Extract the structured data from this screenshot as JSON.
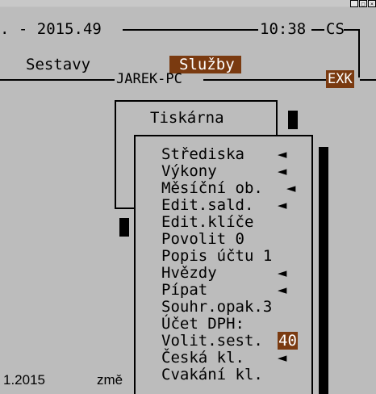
{
  "window": {
    "minimize_icon": "_",
    "maximize_icon": "□",
    "close_icon": "×"
  },
  "status": {
    "left_text": ". - 2015.49",
    "time": "10:38",
    "code": "CS"
  },
  "menu": {
    "item1": "Sestavy",
    "item2": "Služby"
  },
  "bar2": {
    "computer": "JAREK-PC",
    "badge": "EXK"
  },
  "popup1": {
    "title": "Tiskárna"
  },
  "submenu": {
    "items": [
      {
        "label": "Střediska",
        "suffix": "◄"
      },
      {
        "label": "Výkony",
        "suffix": "◄"
      },
      {
        "label": "Měsíční ob.",
        "suffix": "◄"
      },
      {
        "label": "Edit.sald.",
        "suffix": "◄"
      },
      {
        "label": "Edit.klíče",
        "suffix": ""
      },
      {
        "label": "Povolit 0",
        "suffix": ""
      },
      {
        "label": "Popis účtu 1",
        "suffix": ""
      },
      {
        "label": "Hvězdy",
        "suffix": "◄"
      },
      {
        "label": "Pípat",
        "suffix": "◄"
      },
      {
        "label": "Souhr.opak.3",
        "suffix": ""
      },
      {
        "label": "Účet DPH:",
        "suffix": ""
      },
      {
        "label": "Volit.sest.",
        "suffix": "40"
      },
      {
        "label": "Česká kl.",
        "suffix": "◄"
      },
      {
        "label": "Cvakání kl.",
        "suffix": ""
      }
    ]
  },
  "bottom": {
    "date_text": "1.2015",
    "word": "změ"
  },
  "colors": {
    "highlight": "#7a3a10",
    "background": "#bcbcbc"
  }
}
